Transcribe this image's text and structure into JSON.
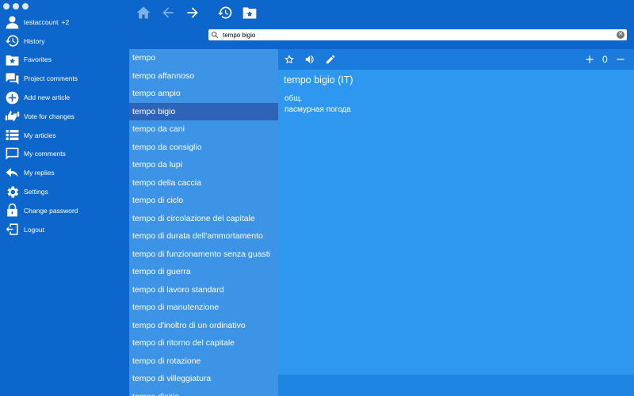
{
  "sidebar": {
    "account": {
      "name": "testaccount",
      "suffix": "+2"
    },
    "items": [
      {
        "label": "History",
        "icon": "history-icon"
      },
      {
        "label": "Favorites",
        "icon": "favorites-icon"
      },
      {
        "label": "Project comments",
        "icon": "comments-icon"
      },
      {
        "label": "Add new article",
        "icon": "add-icon"
      },
      {
        "label": "Vote for changes",
        "icon": "thumbs-icon"
      },
      {
        "label": "My articles",
        "icon": "list-icon"
      },
      {
        "label": "My comments",
        "icon": "comment-icon"
      },
      {
        "label": "My replies",
        "icon": "reply-icon"
      },
      {
        "label": "Settings",
        "icon": "gear-icon"
      },
      {
        "label": "Change password",
        "icon": "lock-icon"
      },
      {
        "label": "Logout",
        "icon": "logout-icon"
      }
    ]
  },
  "search": {
    "value": "tempo bigio",
    "placeholder": ""
  },
  "wordlist": {
    "items": [
      "tempo",
      "tempo affannoso",
      "tempo ampio",
      "tempo bigio",
      "tempo da cani",
      "tempo da consiglio",
      "tempo da lupi",
      "tempo della caccia",
      "tempo di ciclo",
      "tempo di circolazione del capitale",
      "tempo di durata dell'ammortamento",
      "tempo di funzionamento senza guasti",
      "tempo di guerra",
      "tempo di lavoro standard",
      "tempo di manutenzione",
      "tempo d'inoltro di un ordinativo",
      "tempo di ritorno del capitale",
      "tempo di rotazione",
      "tempo di villeggiatura",
      "tempo d'ozio"
    ],
    "selected_index": 3
  },
  "article": {
    "title": "tempo bigio (IT)",
    "category": "общ.",
    "translation": "пасмурная погода",
    "vote_count": "0"
  },
  "colors": {
    "sidebar_bg": "#0d66cc",
    "list_bg": "#3d93e6",
    "selected_bg": "#2f63b8",
    "article_bg": "#2e97ef",
    "toolbar_icon_active": "#ffffff",
    "toolbar_icon_disabled": "#7fb0e8"
  }
}
